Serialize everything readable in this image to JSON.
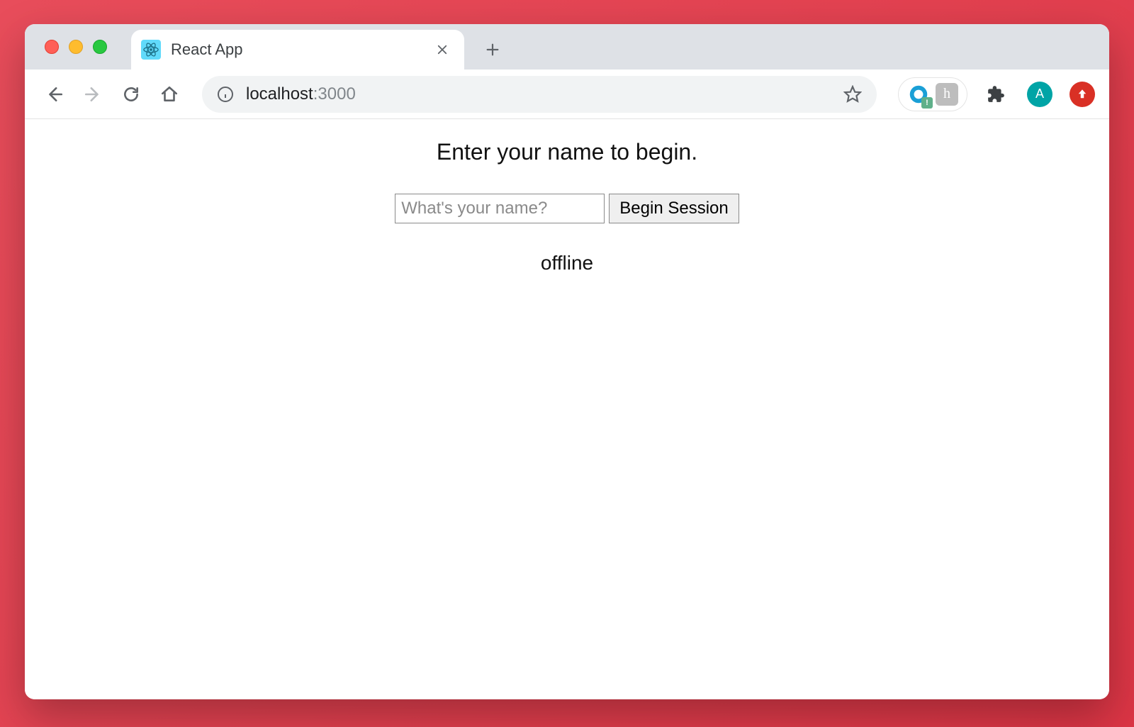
{
  "browser": {
    "tab": {
      "title": "React App",
      "favicon": "react-icon"
    },
    "address": {
      "host": "localhost",
      "port": ":3000"
    },
    "avatar_initial": "A"
  },
  "page": {
    "heading": "Enter your name to begin.",
    "name_input": {
      "placeholder": "What's your name?",
      "value": ""
    },
    "begin_button_label": "Begin Session",
    "status_text": "offline"
  }
}
